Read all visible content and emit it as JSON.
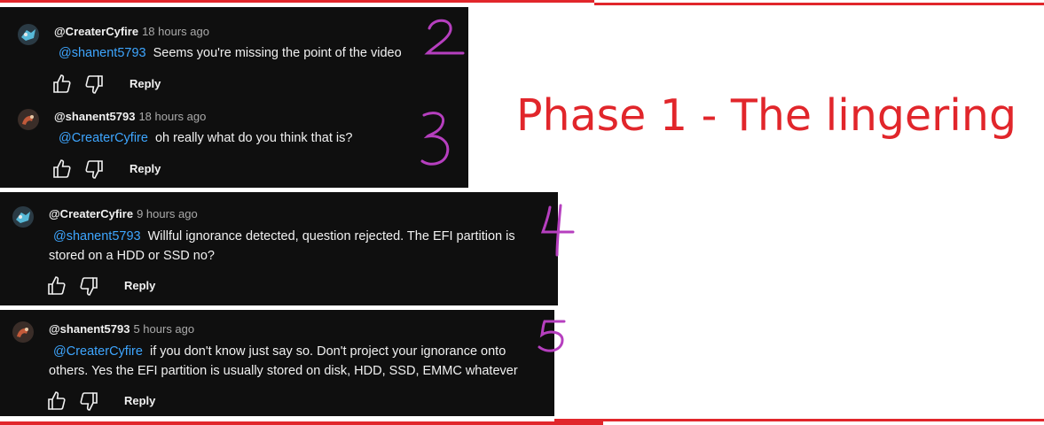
{
  "title": "Phase 1 - The lingering",
  "reply_label": "Reply",
  "comments": [
    {
      "author": "@CreaterCyfire",
      "time": "18 hours ago",
      "mention": "@shanent5793",
      "text": "Seems you're missing the point of the video",
      "annotation": "2"
    },
    {
      "author": "@shanent5793",
      "time": "18 hours ago",
      "mention": "@CreaterCyfire",
      "text": "oh really what do you think that is?",
      "annotation": "3"
    },
    {
      "author": "@CreaterCyfire",
      "time": "9 hours ago",
      "mention": "@shanent5793",
      "text": "Willful ignorance detected, question rejected. The EFI partition is stored on a HDD or SSD no?",
      "annotation": "4"
    },
    {
      "author": "@shanent5793",
      "time": "5 hours ago",
      "mention": "@CreaterCyfire",
      "text": "if you don't know just say so. Don't project your ignorance onto others. Yes the EFI partition is usually stored on disk, HDD, SSD, EMMC whatever",
      "annotation": "5"
    }
  ],
  "colors": {
    "accent_red": "#e1262b",
    "mention_blue": "#3ea6ff",
    "annotation_purple": "#b63fbf",
    "panel_bg": "#0f0f0f"
  },
  "icons": [
    "like-icon",
    "dislike-icon",
    "avatar-cyfire",
    "avatar-shanent"
  ]
}
